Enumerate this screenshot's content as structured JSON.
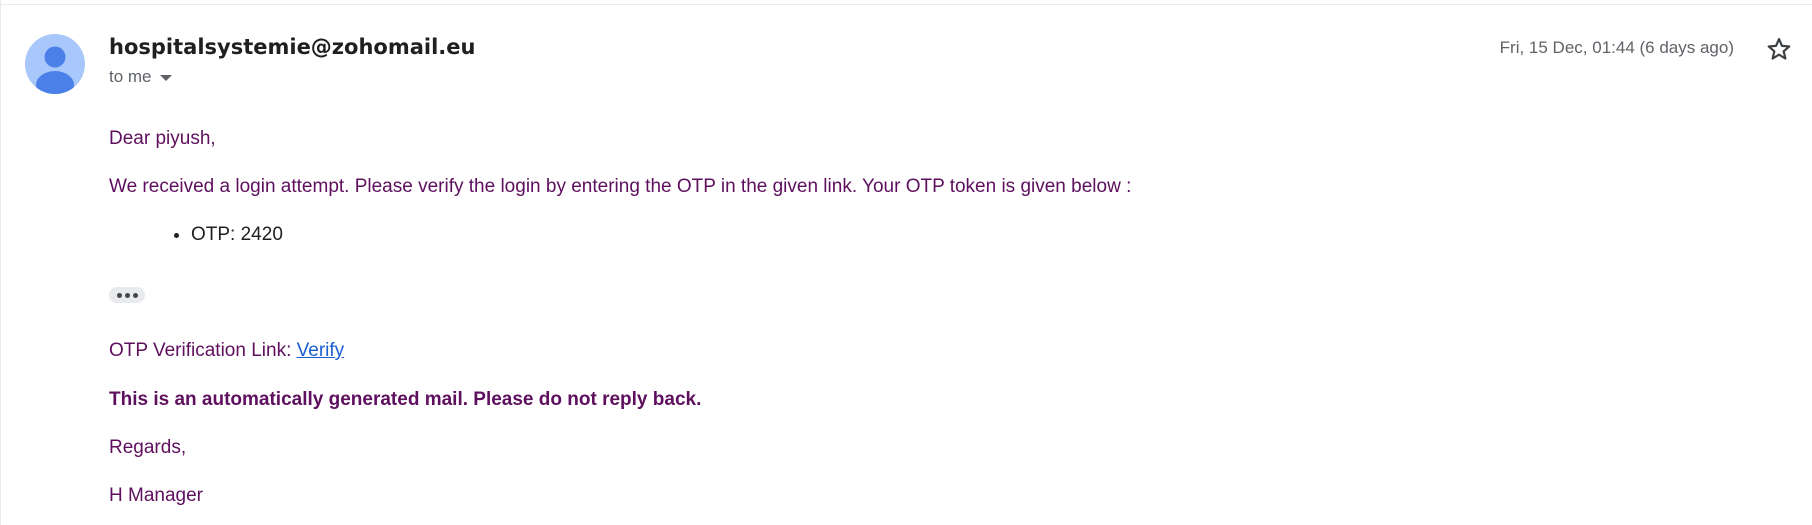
{
  "email": {
    "sender": "hospitalsystemie@zohomail.eu",
    "recipient_label": "to me",
    "date": "Fri, 15 Dec, 01:44 (6 days ago)",
    "greeting": "Dear piyush,",
    "message": "We received a login attempt. Please verify the login by entering the OTP in the given link. Your OTP token is given below :",
    "otp_items": [
      "OTP: 2420"
    ],
    "verification_label": "OTP Verification Link: ",
    "verification_link_text": "Verify",
    "notice": "This is an automatically generated mail. Please do not reply back.",
    "closing": "Regards,",
    "signature": "H Manager"
  },
  "icons": {
    "avatar": "person-avatar-icon",
    "recipient_dropdown": "chevron-down-icon",
    "star": "star-outline-icon",
    "show_trimmed": "more-horizontal-icon"
  },
  "colors": {
    "body_text": "#5e0f5e",
    "link": "#1a5fd0",
    "avatar_bg": "#a8c7fa",
    "avatar_fg": "#4a80e8",
    "secondary_text": "#5f6368"
  }
}
